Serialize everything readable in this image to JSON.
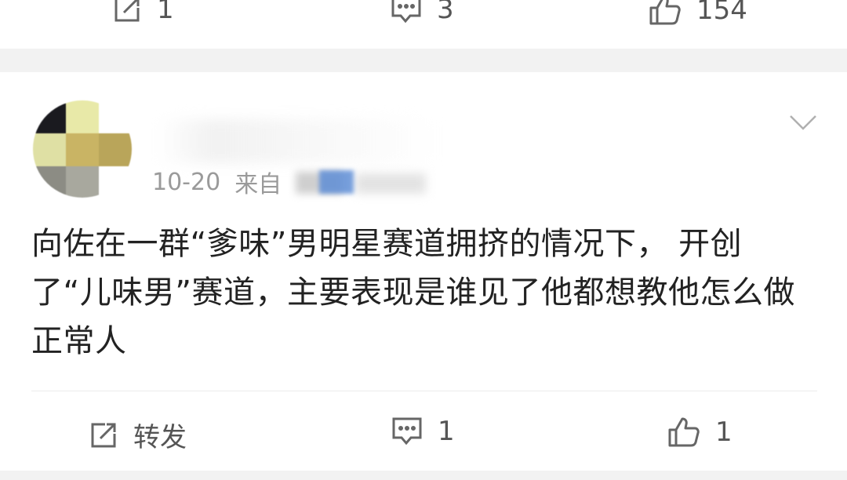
{
  "prev_post": {
    "repost": {
      "icon": "repost-icon",
      "count": "1"
    },
    "comment": {
      "icon": "comment-icon",
      "count": "3"
    },
    "like": {
      "icon": "like-icon",
      "count": "154"
    }
  },
  "post": {
    "date": "10-20",
    "source_prefix": "来自",
    "content": "向佐在一群“爹味”男明星赛道拥挤的情况下， 开创了“儿味男”赛道，主要表现是谁见了他都想教他怎么做正常人",
    "actions": {
      "repost": {
        "icon": "repost-icon",
        "label": "转发"
      },
      "comment": {
        "icon": "comment-icon",
        "count": "1"
      },
      "like": {
        "icon": "like-icon",
        "count": "1"
      }
    }
  },
  "colors": {
    "background": "#ffffff",
    "separator_band": "#f2f2f2",
    "meta_text": "#9a9a9a",
    "body_text": "#222222",
    "icon": "#555555"
  }
}
